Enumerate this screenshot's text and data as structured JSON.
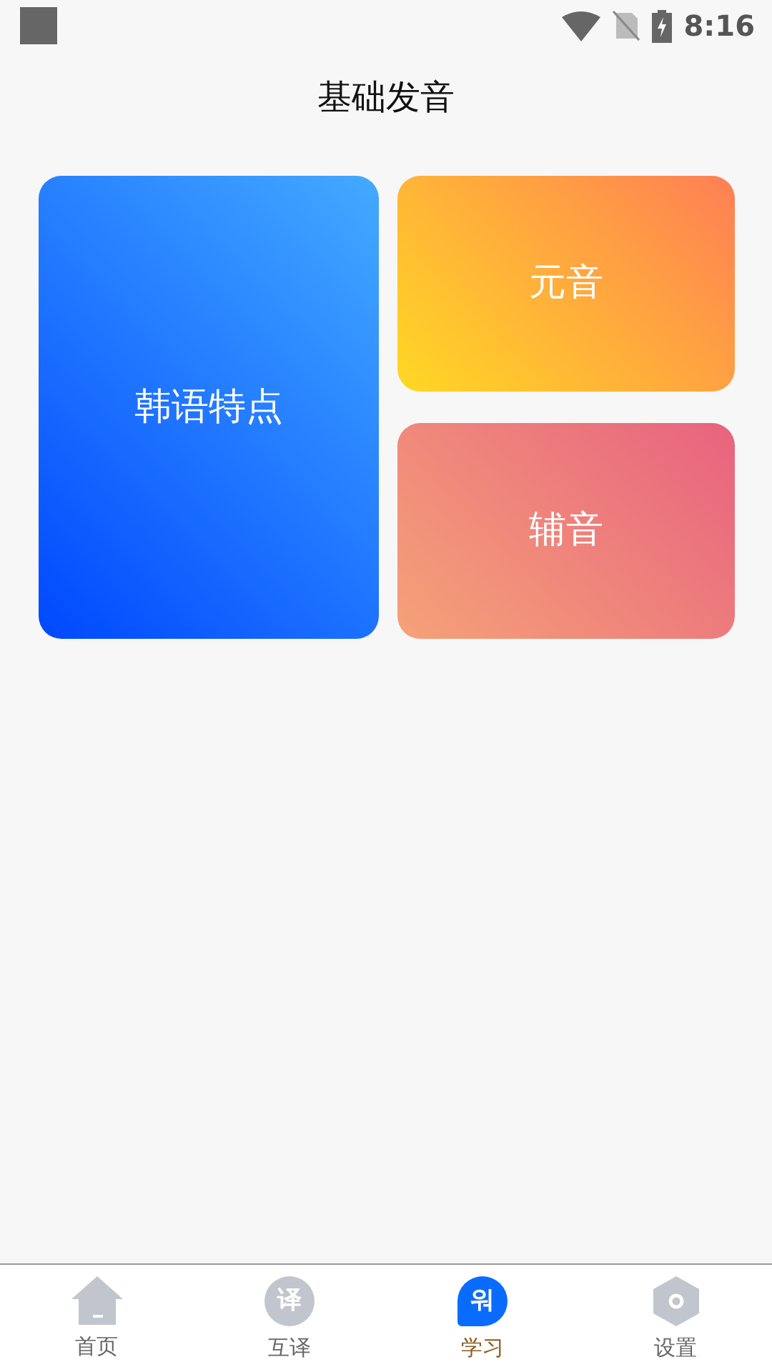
{
  "status_bar": {
    "time": "8:16"
  },
  "header": {
    "title": "基础发音"
  },
  "cards": [
    {
      "label": "韩语特点"
    },
    {
      "label": "元音"
    },
    {
      "label": "辅音"
    }
  ],
  "tabs": [
    {
      "label": "首页",
      "kind": "home",
      "selected": false
    },
    {
      "label": "互译",
      "kind": "circle",
      "glyph": "译",
      "selected": false
    },
    {
      "label": "学习",
      "kind": "bubble",
      "glyph": "워",
      "selected": true
    },
    {
      "label": "设置",
      "kind": "hex",
      "selected": false
    }
  ]
}
